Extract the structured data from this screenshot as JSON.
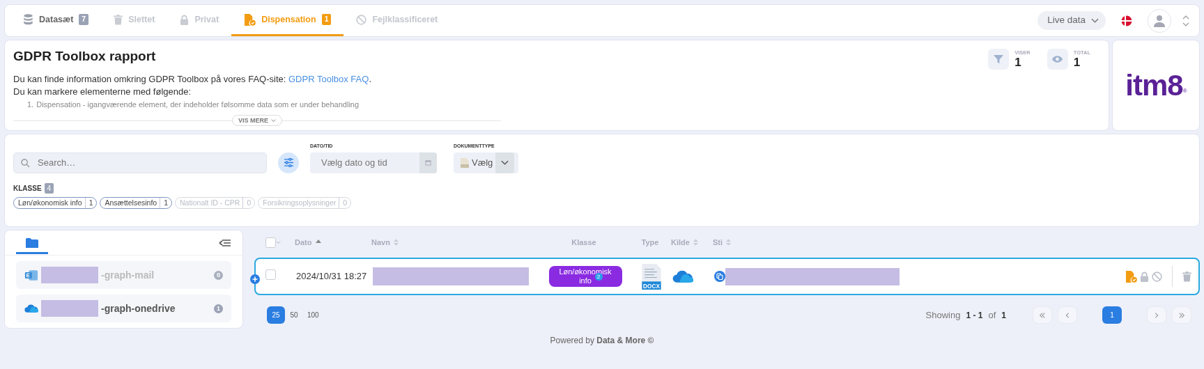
{
  "nav": {
    "tabs": [
      {
        "label": "Datasæt",
        "count": "7",
        "selected": false,
        "disabled": false
      },
      {
        "label": "Slettet",
        "selected": false,
        "disabled": true
      },
      {
        "label": "Privat",
        "selected": false,
        "disabled": true
      },
      {
        "label": "Dispensation",
        "count": "1",
        "selected": true,
        "disabled": false
      },
      {
        "label": "Fejlklassificeret",
        "selected": false,
        "disabled": true
      }
    ],
    "mode": {
      "label": "Live data"
    }
  },
  "report": {
    "title": "GDPR Toolbox rapport",
    "intro": {
      "text": "Du kan finde information omkring GDPR Toolbox på vores FAQ-site: ",
      "link": "GDPR Toolbox FAQ",
      "after": "."
    },
    "line_2": "Du kan markere elementerne med følgende:",
    "list": [
      {
        "number": "1.",
        "text": "Dispensation - igangværende element, der indeholder følsomme data som er under behandling"
      }
    ],
    "more_button": "VIS MERE",
    "stats": [
      {
        "label": "VISER",
        "value": "1"
      },
      {
        "label": "TOTAL",
        "value": "1"
      }
    ],
    "logo": {
      "text": "itm8",
      "mark": "®"
    }
  },
  "filters": {
    "search": {
      "placeholder": "Search…"
    },
    "date": {
      "label": "DATO/TID",
      "placeholder": "Vælg dato og tid"
    },
    "doctype": {
      "label": "DOKUMENTTYPE",
      "value": "Vælg"
    },
    "klasse": {
      "label": "KLASSE",
      "count": "4"
    },
    "chips": [
      {
        "label": "Løn/økonomisk info",
        "count": "1",
        "disabled": false
      },
      {
        "label": "Ansættelsesinfo",
        "count": "1",
        "disabled": false
      },
      {
        "label": "Nationalt ID - CPR",
        "count": "0",
        "disabled": true
      },
      {
        "label": "Forsikringsoplysninger",
        "count": "0",
        "disabled": true
      }
    ]
  },
  "sidebar": {
    "items": [
      {
        "kind": "mail",
        "suffix": "-graph-mail",
        "count": "0",
        "disabled": true
      },
      {
        "kind": "onedrive",
        "suffix": "-graph-onedrive",
        "count": "1",
        "disabled": false
      }
    ]
  },
  "table": {
    "select_all": {
      "checked": false
    },
    "columns": [
      {
        "label": "Dato",
        "sorted": true
      },
      {
        "label": "Navn",
        "sorted": false
      },
      {
        "label": "Klasse"
      },
      {
        "label": "Type"
      },
      {
        "label": "Kilde",
        "sorted": false
      },
      {
        "label": "Sti",
        "sorted": false
      }
    ],
    "rows": [
      {
        "checked": false,
        "date": "2024/10/31 18:27",
        "klasse": "Løn/økonomisk info",
        "klasse_count": "2",
        "type": "DOCX",
        "dispensation": true,
        "private": false,
        "misclassified": false
      }
    ]
  },
  "pagination": {
    "page_sizes": [
      {
        "label": "25",
        "selected": true
      },
      {
        "label": "50",
        "selected": false
      },
      {
        "label": "100",
        "selected": false
      }
    ],
    "showing": "Showing",
    "range": "1 - 1",
    "of": "of",
    "total": "1",
    "pages": [
      {
        "label": "1",
        "selected": true
      }
    ]
  },
  "footer": "Powered by **Data & More ©**"
}
